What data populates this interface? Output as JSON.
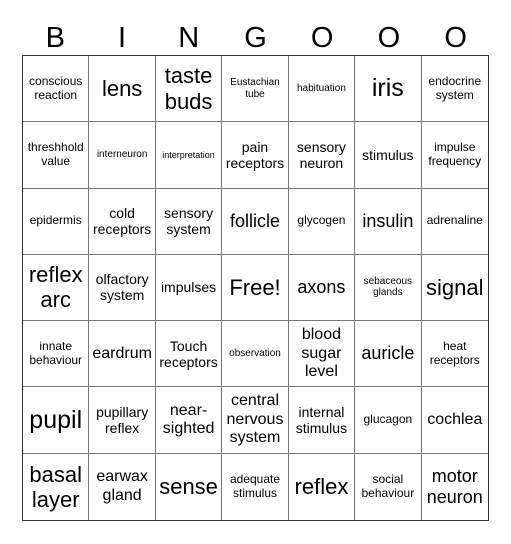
{
  "header": {
    "letters": [
      "B",
      "I",
      "N",
      "G",
      "O",
      "O",
      "O"
    ]
  },
  "board": {
    "rows": [
      [
        "conscious reaction",
        "lens",
        "taste buds",
        "Eustachian tube",
        "habituation",
        "iris",
        "endocrine system"
      ],
      [
        "threshhold value",
        "interneuron",
        "interpretation",
        "pain receptors",
        "sensory neuron",
        "stimulus",
        "impulse frequency"
      ],
      [
        "epidermis",
        "cold receptors",
        "sensory system",
        "follicle",
        "glycogen",
        "insulin",
        "adrenaline"
      ],
      [
        "reflex arc",
        "olfactory system",
        "impulses",
        "Free!",
        "axons",
        "sebaceous glands",
        "signal"
      ],
      [
        "innate behaviour",
        "eardrum",
        "Touch receptors",
        "observation",
        "blood sugar level",
        "auricle",
        "heat receptors"
      ],
      [
        "pupil",
        "pupillary reflex",
        "near-sighted",
        "central nervous system",
        "internal stimulus",
        "glucagon",
        "cochlea"
      ],
      [
        "basal layer",
        "earwax gland",
        "sense",
        "adequate stimulus",
        "reflex",
        "social behaviour",
        "motor neuron"
      ]
    ],
    "free_space": "Free!"
  }
}
